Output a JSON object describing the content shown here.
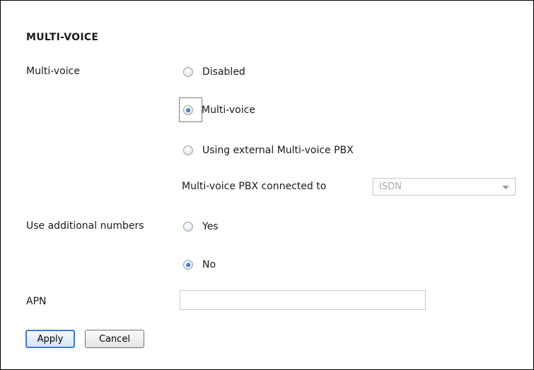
{
  "section": {
    "title": "MULTI-VOICE"
  },
  "multi_voice": {
    "label": "Multi-voice",
    "options": [
      {
        "label": "Disabled",
        "selected": false
      },
      {
        "label": "Multi-voice",
        "selected": true
      },
      {
        "label": "Using external Multi-voice PBX",
        "selected": false
      }
    ],
    "pbx": {
      "label": "Multi-voice PBX connected to",
      "value": "ISDN",
      "disabled": true
    }
  },
  "additional_numbers": {
    "label": "Use additional numbers",
    "options": [
      {
        "label": "Yes",
        "selected": false
      },
      {
        "label": "No",
        "selected": true
      }
    ]
  },
  "apn": {
    "label": "APN",
    "value": ""
  },
  "actions": {
    "apply_label": "Apply",
    "cancel_label": "Cancel"
  }
}
